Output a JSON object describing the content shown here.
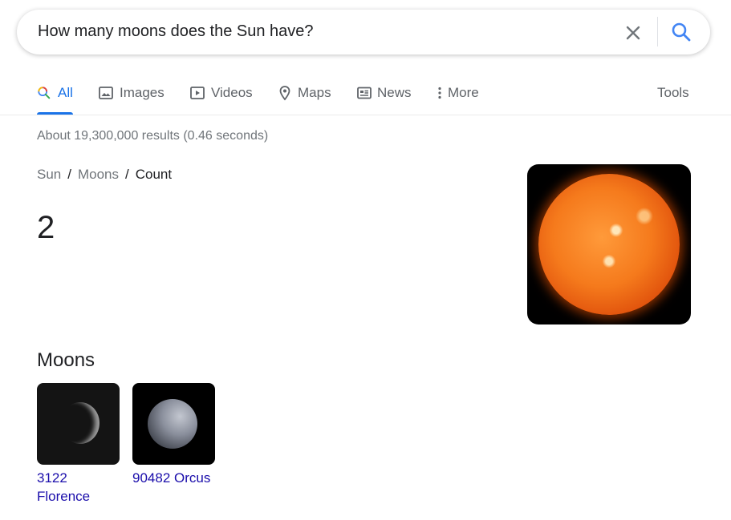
{
  "search": {
    "query": "How many moons does the Sun have?",
    "clear_icon": "close-icon",
    "search_icon": "search-icon"
  },
  "tabs": [
    {
      "label": "All",
      "icon": "search-icon",
      "active": true
    },
    {
      "label": "Images",
      "icon": "image-icon"
    },
    {
      "label": "Videos",
      "icon": "play-icon"
    },
    {
      "label": "Maps",
      "icon": "map-pin-icon"
    },
    {
      "label": "News",
      "icon": "news-icon"
    },
    {
      "label": "More",
      "icon": "more-vert-icon"
    }
  ],
  "tools_label": "Tools",
  "stats": "About 19,300,000 results (0.46 seconds)",
  "breadcrumb": {
    "crumb1": "Sun",
    "crumb2": "Moons",
    "current": "Count",
    "separator": "/"
  },
  "answer": "2",
  "moons_section": {
    "heading": "Moons",
    "items": [
      {
        "name": "3122 Florence"
      },
      {
        "name": "90482 Orcus"
      }
    ]
  },
  "colors": {
    "accent": "#1a73e8",
    "link": "#1a0dab",
    "muted": "#70757a"
  }
}
